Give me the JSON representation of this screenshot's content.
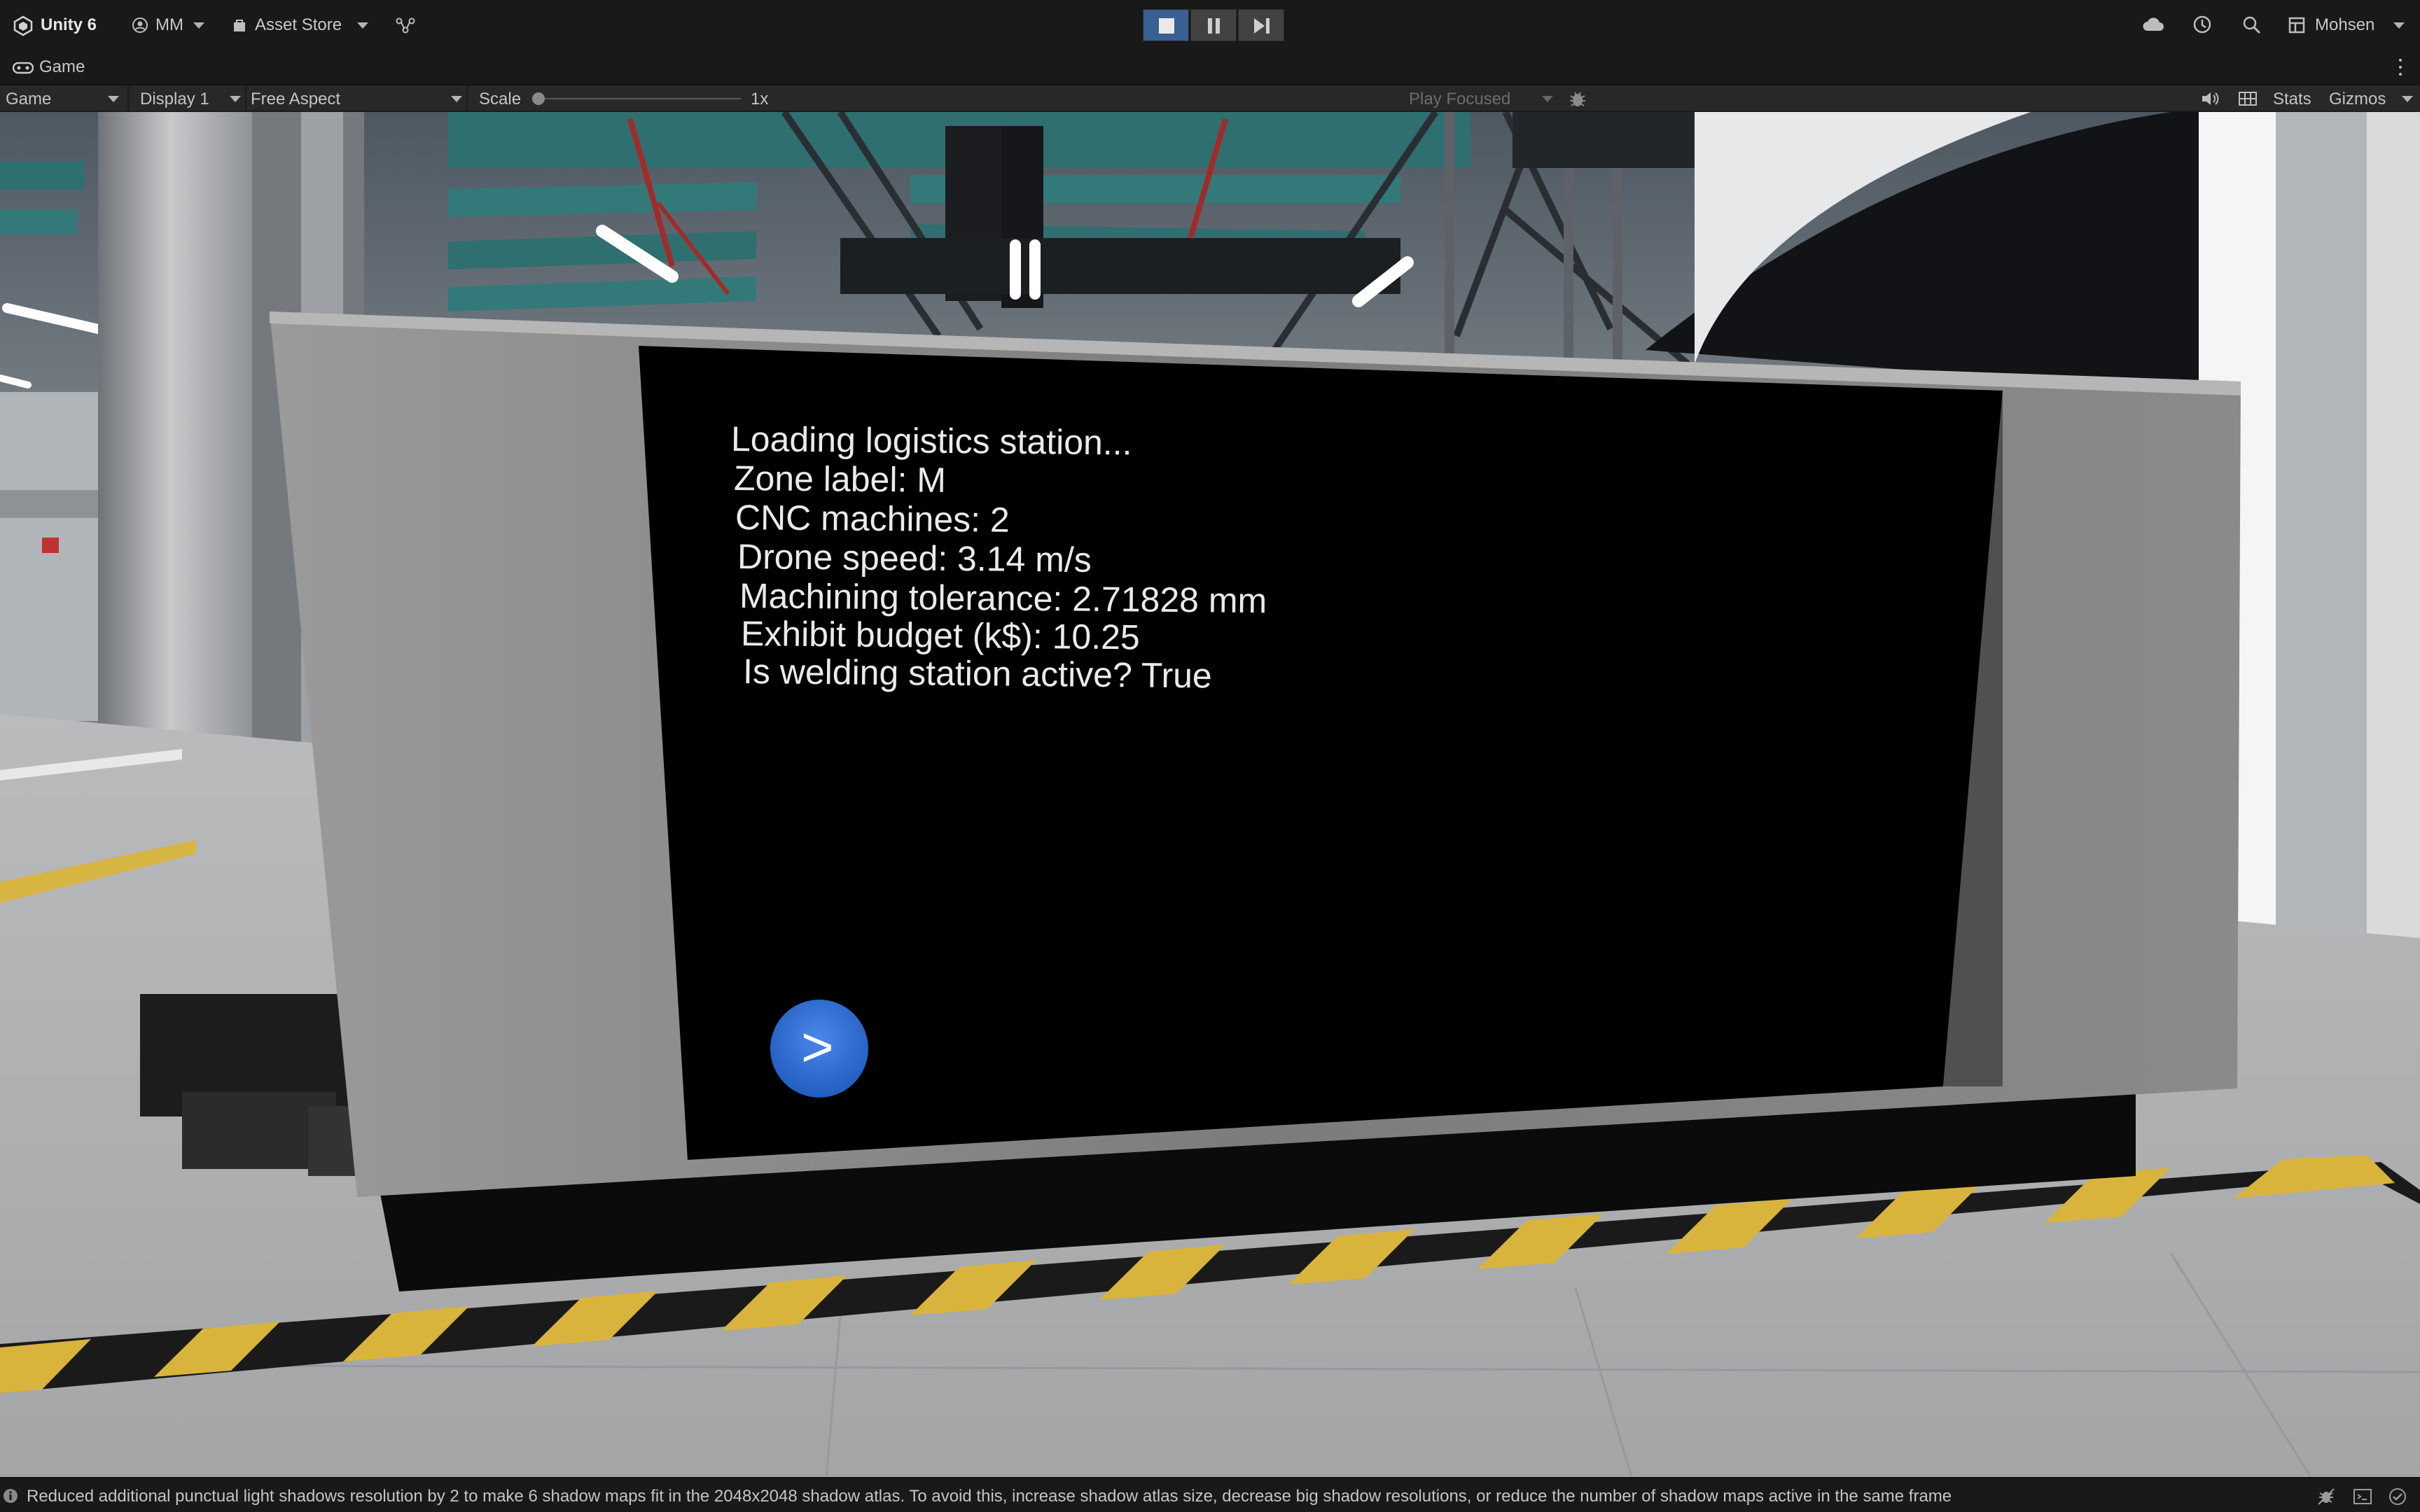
{
  "toolbar": {
    "app_title": "Unity 6",
    "account_label": "MM",
    "asset_store_label": "Asset Store",
    "user_label": "Mohsen",
    "icons": [
      "unity-logo-icon",
      "user-icon",
      "bag-icon",
      "version-control-icon",
      "play-icon",
      "pause-icon",
      "step-icon",
      "cloud-icon",
      "history-icon",
      "search-icon",
      "layout-icon"
    ]
  },
  "tab": {
    "label": "Game",
    "icon": "gamepad-icon"
  },
  "game_toolbar": {
    "view_mode": "Game",
    "display": "Display 1",
    "aspect": "Free Aspect",
    "scale_label": "Scale",
    "scale_value": "1x",
    "play_mode": "Play Focused",
    "stats_label": "Stats",
    "gizmos_label": "Gizmos",
    "icons": [
      "bug-icon",
      "audio-icon",
      "grid-icon"
    ]
  },
  "scene": {
    "screen_lines": [
      "Loading logistics station...",
      "Zone label: M",
      "CNC machines: 2",
      "Drone speed: 3.14 m/s",
      "Machining tolerance: 2.71828 mm",
      "Exhibit budget (k$): 10.25",
      "Is welding station active? True"
    ],
    "next_button_label": ">",
    "colors": {
      "next_button": "#2f6fd6",
      "hazard_yellow": "#d9b43c",
      "panel_frame": "#8e8e8e",
      "screen": "#000000"
    }
  },
  "status": {
    "message": "Reduced additional punctual light shadows resolution by 2 to make 6 shadow maps fit in the 2048x2048 shadow atlas. To avoid this, increase shadow atlas size, decrease big shadow resolutions, or reduce the number of shadow maps active in the same frame",
    "icons": [
      "info-icon",
      "debug-icon",
      "console-icon",
      "check-icon"
    ]
  }
}
